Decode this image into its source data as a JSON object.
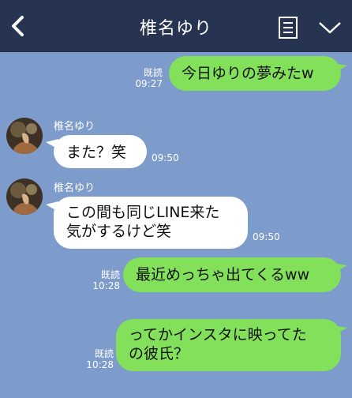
{
  "header": {
    "title": "椎名ゆり"
  },
  "messages": [
    {
      "type": "out",
      "text": "今日ゆりの夢みたw",
      "read": "既読",
      "time": "09:27"
    },
    {
      "type": "in",
      "sender": "椎名ゆり",
      "text": "また？笑",
      "time": "09:50"
    },
    {
      "type": "in",
      "sender": "椎名ゆり",
      "line1": "この間も同じLINE来た",
      "line2": "気がするけど笑",
      "time": "09:50"
    },
    {
      "type": "out",
      "text": "最近めっちゃ出てくるww",
      "read": "既読",
      "time": "10:28"
    },
    {
      "type": "out",
      "line1": "ってかインスタに映ってた",
      "line2": "の彼氏？",
      "read": "既読",
      "time": "10:28"
    }
  ],
  "colors": {
    "background": "#7d9ccb",
    "header": "#263351",
    "outgoing_bubble": "#82e05a",
    "incoming_bubble": "#ffffff"
  },
  "icons": {
    "back": "back-arrow-icon",
    "menu": "notes-menu-icon",
    "dropdown": "chevron-down-icon"
  }
}
